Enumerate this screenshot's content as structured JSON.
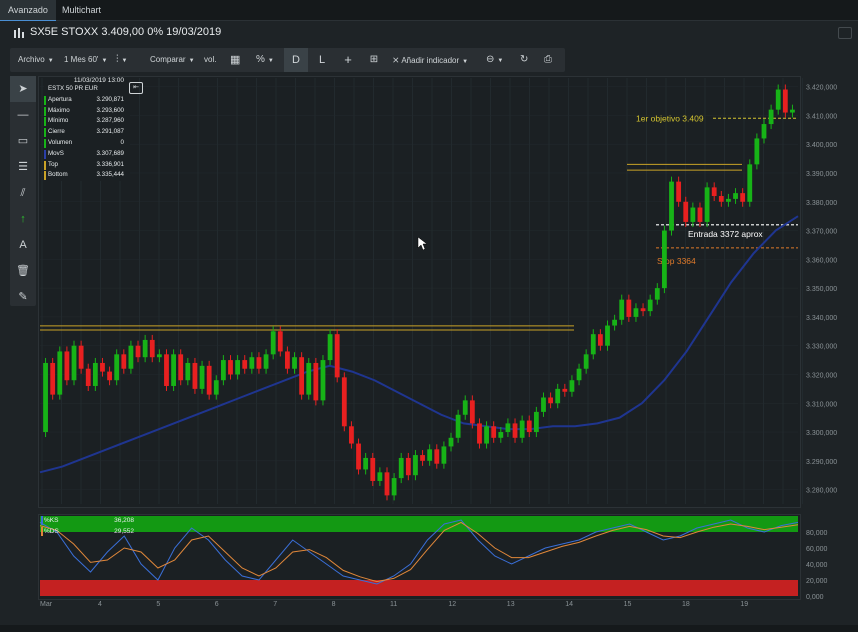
{
  "tabs": [
    {
      "label": "Avanzado"
    },
    {
      "label": "Multichart"
    }
  ],
  "header": {
    "title": "SX5E STOXX 3.409,00 0% 19/03/2019"
  },
  "toolbar": {
    "archivo": "Archivo",
    "interval": "1 Mes 60'",
    "comparar": "Comparar",
    "vol": "vol.",
    "pct": "%",
    "d": "D",
    "l": "L",
    "indicador": "Añadir indicador"
  },
  "sidebar": {
    "text_tool": "A"
  },
  "infobox": {
    "date": "11/03/2019 13:00",
    "instrument": "ESTX 50 PR EUR",
    "rows": [
      {
        "label": "Apertura",
        "value": "3.290,871",
        "color": ""
      },
      {
        "label": "Máximo",
        "value": "3.293,600",
        "color": ""
      },
      {
        "label": "Mínimo",
        "value": "3.287,960",
        "color": ""
      },
      {
        "label": "Cierre",
        "value": "3.291,087",
        "color": ""
      },
      {
        "label": "Volumen",
        "value": "0",
        "color": ""
      },
      {
        "label": "MovS",
        "value": "3.307,689",
        "color": "#2b3fa8"
      },
      {
        "label": "Top",
        "value": "3.336,901",
        "color": "#c9a227"
      },
      {
        "label": "Bottom",
        "value": "3.335,444",
        "color": "#c9a227"
      }
    ]
  },
  "annotations": {
    "objetivo": "1er objetivo 3.409",
    "entrada": "Entrada 3372 aprox",
    "stop": "Stop 3364"
  },
  "stochastic": {
    "ks_label": "%KS",
    "ks_value": "36,208",
    "ds_label": "%DS",
    "ds_value": "29,552",
    "y_ticks": [
      "80,000",
      "60,000",
      "40,000",
      "20,000",
      "0,000"
    ]
  },
  "colors": {
    "up": "#17b317",
    "down": "#e82020",
    "ma": "#1f3590",
    "level": "#c9a227",
    "objetivo": "#d4c430",
    "stop": "#e07a2a",
    "ks": "#3a6fd8",
    "ds": "#e0873a"
  },
  "chart_data": {
    "type": "candlestick",
    "y_ticks": [
      "3.420,000",
      "3.410,000",
      "3.400,000",
      "3.390,000",
      "3.380,000",
      "3.370,000",
      "3.360,000",
      "3.350,000",
      "3.340,000",
      "3.330,000",
      "3.320,000",
      "3.310,000",
      "3.300,000",
      "3.290,000",
      "3.280,000"
    ],
    "ylim": [
      3275,
      3423
    ],
    "x_ticks": [
      "Mar",
      "4",
      "5",
      "6",
      "7",
      "8",
      "11",
      "12",
      "13",
      "14",
      "15",
      "18",
      "19"
    ],
    "levels": {
      "top": 3336.901,
      "bottom": 3335.444,
      "upper_zone_top": 3393,
      "upper_zone_bottom": 3391,
      "objetivo": 3409,
      "entrada": 3372,
      "stop": 3364
    },
    "candles": [
      [
        3300,
        3324
      ],
      [
        3324,
        3313
      ],
      [
        3313,
        3328
      ],
      [
        3328,
        3318
      ],
      [
        3318,
        3330
      ],
      [
        3330,
        3322
      ],
      [
        3322,
        3316
      ],
      [
        3316,
        3324
      ],
      [
        3324,
        3321
      ],
      [
        3321,
        3318
      ],
      [
        3318,
        3327
      ],
      [
        3327,
        3322
      ],
      [
        3322,
        3330
      ],
      [
        3330,
        3326
      ],
      [
        3326,
        3332
      ],
      [
        3332,
        3326
      ],
      [
        3326,
        3327
      ],
      [
        3327,
        3316
      ],
      [
        3316,
        3327
      ],
      [
        3327,
        3318
      ],
      [
        3318,
        3324
      ],
      [
        3324,
        3315
      ],
      [
        3315,
        3323
      ],
      [
        3323,
        3313
      ],
      [
        3313,
        3318
      ],
      [
        3318,
        3325
      ],
      [
        3325,
        3320
      ],
      [
        3320,
        3325
      ],
      [
        3325,
        3322
      ],
      [
        3322,
        3326
      ],
      [
        3326,
        3322
      ],
      [
        3322,
        3327
      ],
      [
        3327,
        3335
      ],
      [
        3335,
        3328
      ],
      [
        3328,
        3322
      ],
      [
        3322,
        3326
      ],
      [
        3326,
        3313
      ],
      [
        3313,
        3324
      ],
      [
        3324,
        3311
      ],
      [
        3311,
        3325
      ],
      [
        3325,
        3334
      ],
      [
        3334,
        3319
      ],
      [
        3319,
        3302
      ],
      [
        3302,
        3296
      ],
      [
        3296,
        3287
      ],
      [
        3287,
        3291
      ],
      [
        3291,
        3283
      ],
      [
        3283,
        3286
      ],
      [
        3286,
        3278
      ],
      [
        3278,
        3284
      ],
      [
        3284,
        3291
      ],
      [
        3291,
        3285
      ],
      [
        3285,
        3292
      ],
      [
        3292,
        3290
      ],
      [
        3290,
        3294
      ],
      [
        3294,
        3289
      ],
      [
        3289,
        3295
      ],
      [
        3295,
        3298
      ],
      [
        3298,
        3306
      ],
      [
        3306,
        3311
      ],
      [
        3311,
        3303
      ],
      [
        3303,
        3296
      ],
      [
        3296,
        3302
      ],
      [
        3302,
        3298
      ],
      [
        3298,
        3300
      ],
      [
        3300,
        3303
      ],
      [
        3303,
        3298
      ],
      [
        3298,
        3304
      ],
      [
        3304,
        3300
      ],
      [
        3300,
        3307
      ],
      [
        3307,
        3312
      ],
      [
        3312,
        3310
      ],
      [
        3310,
        3315
      ],
      [
        3315,
        3314
      ],
      [
        3314,
        3318
      ],
      [
        3318,
        3322
      ],
      [
        3322,
        3327
      ],
      [
        3327,
        3334
      ],
      [
        3334,
        3330
      ],
      [
        3330,
        3337
      ],
      [
        3337,
        3339
      ],
      [
        3339,
        3346
      ],
      [
        3346,
        3340
      ],
      [
        3340,
        3343
      ],
      [
        3343,
        3342
      ],
      [
        3342,
        3346
      ],
      [
        3346,
        3350
      ],
      [
        3350,
        3370
      ],
      [
        3370,
        3387
      ],
      [
        3387,
        3380
      ],
      [
        3380,
        3373
      ],
      [
        3373,
        3378
      ],
      [
        3378,
        3373
      ],
      [
        3373,
        3385
      ],
      [
        3385,
        3382
      ],
      [
        3382,
        3380
      ],
      [
        3380,
        3381
      ],
      [
        3381,
        3383
      ],
      [
        3383,
        3380
      ],
      [
        3380,
        3393
      ],
      [
        3393,
        3402
      ],
      [
        3402,
        3407
      ],
      [
        3407,
        3412
      ],
      [
        3412,
        3419
      ],
      [
        3419,
        3411
      ],
      [
        3411,
        3412
      ]
    ],
    "ma": [
      3286,
      3288,
      3291,
      3294,
      3297,
      3300,
      3303,
      3306,
      3309,
      3312,
      3315,
      3318,
      3321,
      3323,
      3321,
      3318,
      3314,
      3310,
      3306,
      3303,
      3302,
      3301,
      3301,
      3302,
      3302,
      3303,
      3305,
      3310,
      3318,
      3328,
      3340,
      3352,
      3362,
      3370,
      3375
    ],
    "stoch_ks": [
      92,
      80,
      50,
      30,
      55,
      75,
      40,
      20,
      60,
      85,
      70,
      45,
      25,
      20,
      45,
      70,
      55,
      40,
      25,
      20,
      15,
      25,
      40,
      70,
      90,
      95,
      70,
      50,
      40,
      50,
      60,
      65,
      70,
      80,
      85,
      90,
      80,
      70,
      75,
      85,
      90,
      95,
      85,
      80,
      88,
      92
    ],
    "stoch_ds": [
      88,
      82,
      65,
      42,
      45,
      60,
      55,
      35,
      45,
      70,
      75,
      55,
      35,
      25,
      35,
      55,
      58,
      48,
      32,
      24,
      18,
      22,
      33,
      58,
      82,
      92,
      78,
      60,
      48,
      48,
      55,
      62,
      67,
      75,
      82,
      87,
      83,
      75,
      73,
      80,
      86,
      90,
      87,
      83,
      86,
      89
    ]
  }
}
